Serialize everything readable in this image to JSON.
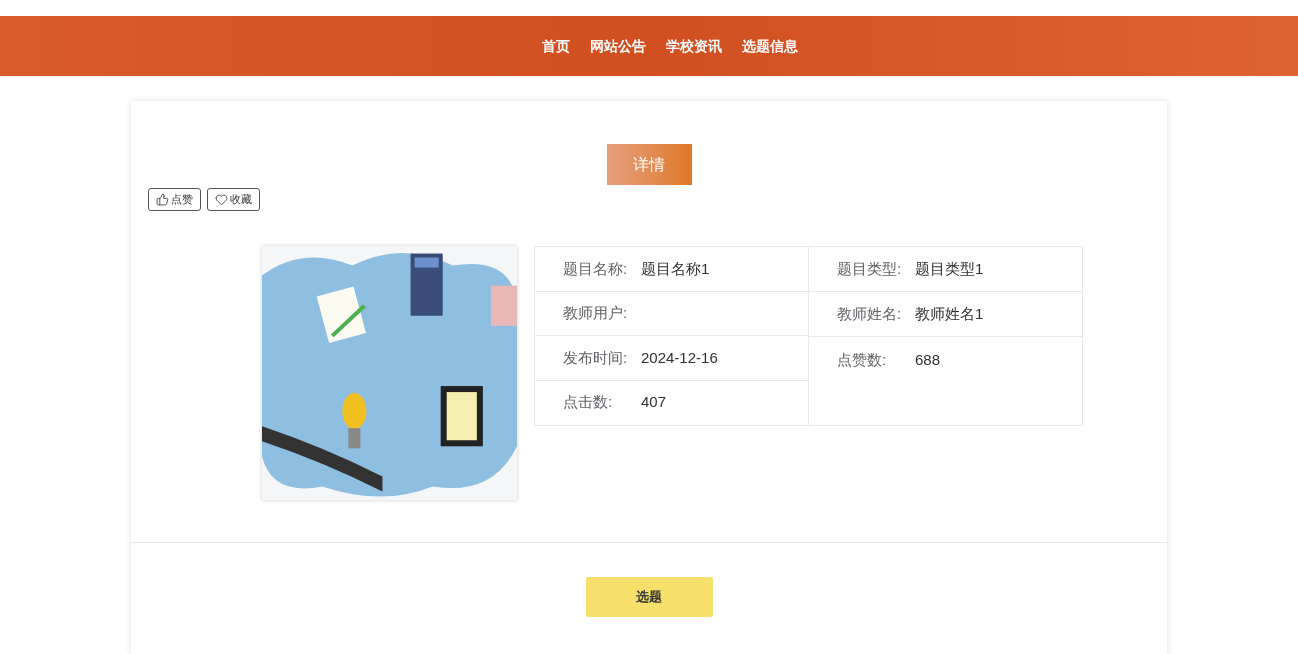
{
  "nav": {
    "items": [
      "首页",
      "网站公告",
      "学校资讯",
      "选题信息"
    ]
  },
  "detail": {
    "title": "详情",
    "actions": [
      {
        "kind": "like",
        "label": "点赞"
      },
      {
        "kind": "favorite",
        "label": "收藏"
      }
    ],
    "left_fields": [
      {
        "label": "题目名称:",
        "value": "题目名称1"
      },
      {
        "label": "教师用户:"
      },
      {
        "label": "发布时间:",
        "value": "2024-12-16"
      },
      {
        "label": "点击数:",
        "value": "407"
      }
    ],
    "right_fields": [
      {
        "label": "题目类型:",
        "value": "题目类型1"
      },
      {
        "label": "教师姓名:",
        "value": "教师姓名1"
      },
      {
        "label": "点赞数:",
        "value": "688"
      }
    ],
    "primary_button": "选题"
  }
}
